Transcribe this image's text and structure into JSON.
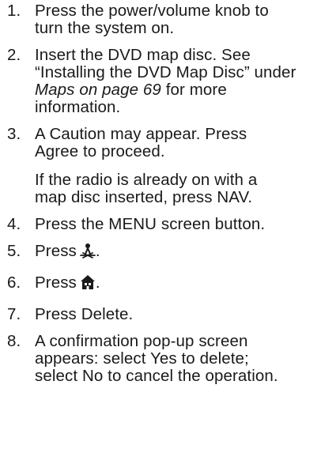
{
  "steps": [
    {
      "number": "1.",
      "text": "Press the power/volume knob to turn the system on."
    },
    {
      "number": "2.",
      "pre": "Insert the DVD map disc. See “Installing the DVD Map Disc” under ",
      "italic": "Maps on page 69",
      "post": " for more information."
    },
    {
      "number": "3.",
      "text": "A Caution may appear. Press Agree to proceed.",
      "note": "If the radio is already on with a map disc inserted, press NAV."
    },
    {
      "number": "4.",
      "text": "Press the MENU screen button."
    },
    {
      "number": "5.",
      "pre": "Press",
      "post": ".",
      "icon": "map-pin-person-icon"
    },
    {
      "number": "6.",
      "pre": "Press",
      "post": ".",
      "icon": "home-icon"
    },
    {
      "number": "7.",
      "text": "Press Delete."
    },
    {
      "number": "8.",
      "text": "A confirmation pop-up screen appears: select Yes to delete; select No to cancel the operation."
    }
  ]
}
